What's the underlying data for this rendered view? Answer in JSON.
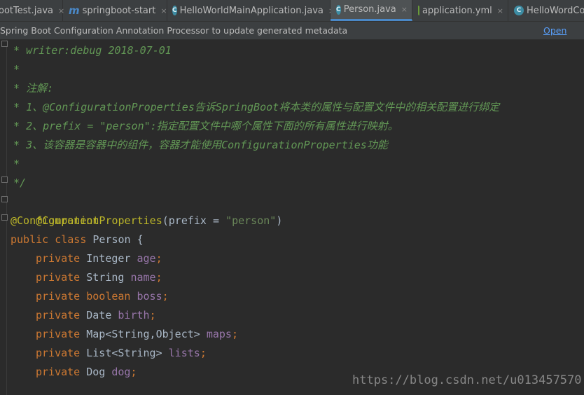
{
  "tabs": [
    {
      "label": "ootTest.java",
      "icon": "none"
    },
    {
      "label": "springboot-start",
      "icon": "maven-icon",
      "icon_glyph": "m"
    },
    {
      "label": "HelloWorldMainApplication.java",
      "icon": "class-icon",
      "icon_glyph": "C"
    },
    {
      "label": "Person.java",
      "icon": "class-icon",
      "icon_glyph": "C",
      "active": true
    },
    {
      "label": "application.yml",
      "icon": "spring-icon"
    },
    {
      "label": "HelloWordCon",
      "icon": "class-icon",
      "icon_glyph": "C"
    }
  ],
  "tab_close_glyph": "×",
  "notice": {
    "message": "Spring Boot Configuration Annotation Processor to update generated metadata",
    "link": "Open Doc"
  },
  "code": {
    "line1": " * writer:debug 2018-07-01",
    "line2": " *",
    "line3": " * 注解:",
    "line4": " * 1、@ConfigurationProperties告诉SpringBoot将本类的属性与配置文件中的相关配置进行绑定",
    "line5": " * 2、prefix = \"person\":指定配置文件中哪个属性下面的所有属性进行映射。",
    "line6": " * 3、该容器是容器中的组件，容器才能使用ConfigurationProperties功能",
    "line7": " *",
    "line8": " */",
    "line9_annot": "@Component",
    "line10_annot": "@ConfigurationProperties",
    "line10_open": "(prefix = ",
    "line10_str": "\"person\"",
    "line10_close": ")",
    "line11_kw": "public class",
    "line11_rest": " Person {",
    "fields": [
      {
        "kw": "private",
        "type": " Integer ",
        "name": "age",
        "semi": ";"
      },
      {
        "kw": "private",
        "type": " String ",
        "name": "name",
        "semi": ";"
      },
      {
        "kw": "private",
        "type": " ",
        "type_kw": "boolean",
        "type_after": " ",
        "name": "boss",
        "semi": ";"
      },
      {
        "kw": "private",
        "type": " Date ",
        "name": "birth",
        "semi": ";"
      },
      {
        "kw": "private",
        "type": " Map<String,Object> ",
        "name": "maps",
        "semi": ";"
      },
      {
        "kw": "private",
        "type": " List<String> ",
        "name": "lists",
        "semi": ";"
      },
      {
        "kw": "private",
        "type": " Dog ",
        "name": "dog",
        "semi": ";"
      }
    ]
  },
  "watermark": "https://blog.csdn.net/u013457570",
  "colors": {
    "background": "#2b2b2b",
    "comment": "#629755",
    "annotation": "#bbb529",
    "keyword": "#cc7832",
    "field": "#9876aa",
    "string": "#6a8759",
    "text": "#a9b7c6",
    "accent": "#4a88c7"
  }
}
